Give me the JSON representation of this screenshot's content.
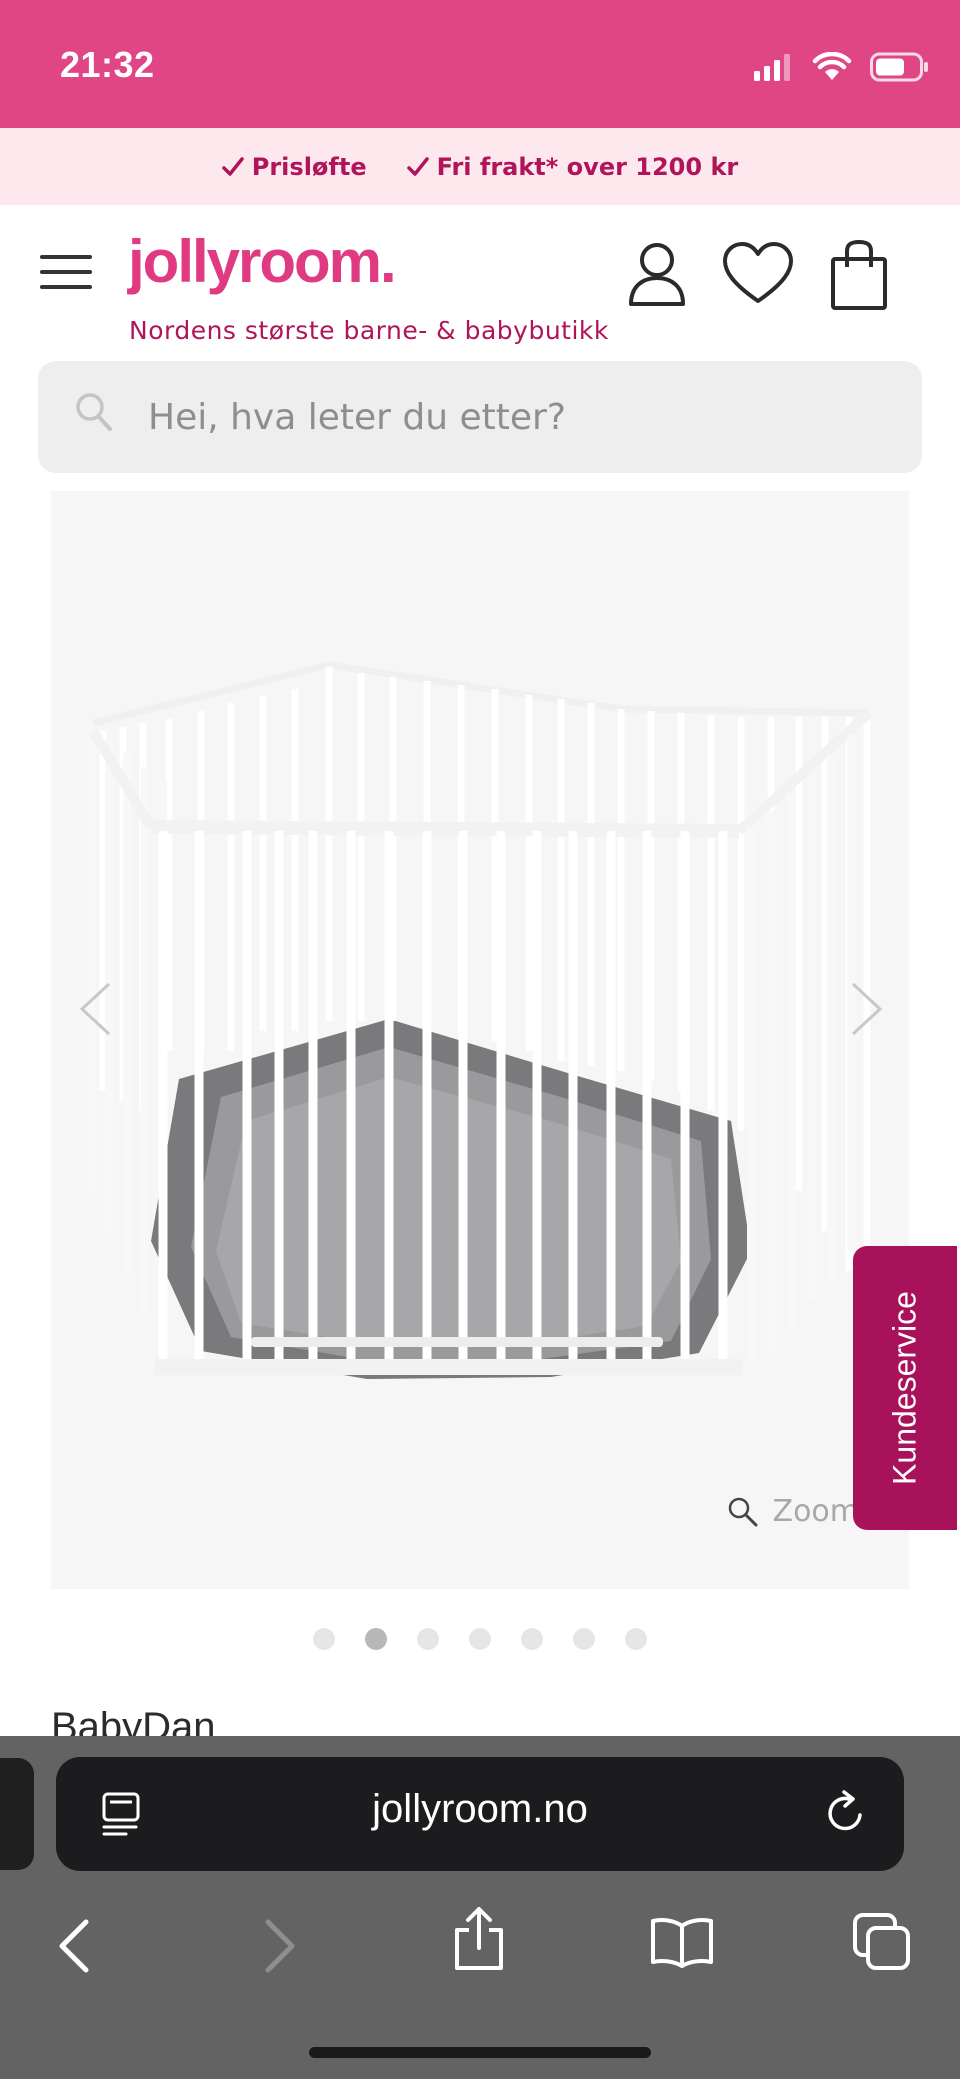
{
  "status_bar": {
    "time": "21:32"
  },
  "promo": {
    "item1": "Prisløfte",
    "item2": "Fri frakt* over 1200 kr"
  },
  "header": {
    "logo": "jollyroom.",
    "tagline": "Nordens største barne- & babybutikk"
  },
  "search": {
    "placeholder": "Hei, hva leter du etter?"
  },
  "gallery": {
    "zoom_label": "Zoom",
    "current_index": 2,
    "total_images": 7
  },
  "customer_service": {
    "label": "Kundeservice"
  },
  "product": {
    "brand": "BabyDan"
  },
  "browser": {
    "url": "jollyroom.no"
  },
  "colors": {
    "brand_pink": "#e04585",
    "brand_dark": "#b0145a",
    "cs_tab": "#a8125a"
  }
}
